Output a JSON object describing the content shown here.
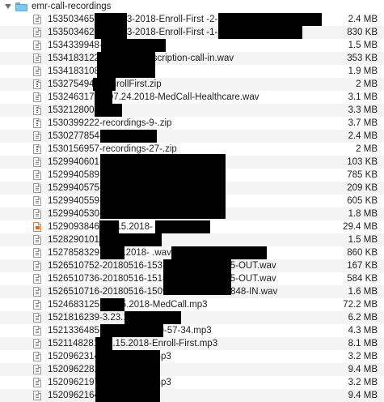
{
  "folder": {
    "name": "emr-call-recordings",
    "icon": "folder-icon"
  },
  "files": [
    {
      "name": "1535034651-          -08-23-2018-Enroll-First                        -2-.wav",
      "size": "2.4 MB",
      "icon": "audio"
    },
    {
      "name": "1535034621-          -08-23-2018-Enroll-First                        -1-.wav",
      "size": "830 KB",
      "icon": "audio"
    },
    {
      "name": "1534339948-                  8.15.18.wav",
      "size": "1.5 MB",
      "icon": "audio"
    },
    {
      "name": "1534183122-                  8.13.18-prescription-call-in.wav",
      "size": "353 KB",
      "icon": "audio"
    },
    {
      "name": "1534183108-                  8.13.18.wav",
      "size": "1.9 MB",
      "icon": "audio"
    },
    {
      "name": "1532754941-      EnrollFirst.zip",
      "size": "2 MB",
      "icon": "zip"
    },
    {
      "name": "1532463175-      -07.24.2018-MedCall-Healthcare.wav",
      "size": "3.1 MB",
      "icon": "audio"
    },
    {
      "name": "1532128004-          .zip",
      "size": "3.3 MB",
      "icon": "zip"
    },
    {
      "name": "1530399222-recordings-9-.zip",
      "size": "3.7 MB",
      "icon": "zip"
    },
    {
      "name": "1530277854-                   6.29.18.wav",
      "size": "2.4 MB",
      "icon": "audio"
    },
    {
      "name": "1530156957-recordings-27-.zip",
      "size": "2 MB",
      "icon": "zip"
    },
    {
      "name": "1529940601-                                    4.wav",
      "size": "103 KB",
      "icon": "audio"
    },
    {
      "name": "1529940589-                                    3.wav",
      "size": "785 KB",
      "icon": "audio"
    },
    {
      "name": "1529940575-                                    2.wav",
      "size": "209 KB",
      "icon": "audio"
    },
    {
      "name": "1529940559-                                    1.wav",
      "size": "605 KB",
      "icon": "audio"
    },
    {
      "name": "1529940530-                                    .wav",
      "size": "1.8 MB",
      "icon": "audio"
    },
    {
      "name": "1529093846-      -6.15.2018-                 ",
      "size": "29.4 MB",
      "icon": "doc"
    },
    {
      "name": "1528290101-             -6.6.18.wav",
      "size": "1.5 MB",
      "icon": "audio"
    },
    {
      "name": "1527858329-          06012018-                         .wav",
      "size": "860 KB",
      "icon": "audio"
    },
    {
      "name": "1526510752-20180516-153756-                  7135827325-OUT.wav",
      "size": "167 KB",
      "icon": "audio"
    },
    {
      "name": "1526510736-20180516-151849-                  7135827325-OUT.wav",
      "size": "584 KB",
      "icon": "audio"
    },
    {
      "name": "1526510716-20180516-150928-                  +19406132848-IN.wav",
      "size": "1.6 MB",
      "icon": "audio"
    },
    {
      "name": "1524683125-             -4.25.2018-MedCall.mp3",
      "size": "72.2 MB",
      "icon": "audio"
    },
    {
      "name": "1521816239-3.23.18-                 .mp3",
      "size": "6.2 MB",
      "icon": "audio"
    },
    {
      "name": "1521336485-                  -2018-3-17-20-57-34.mp3",
      "size": "4.3 MB",
      "icon": "audio"
    },
    {
      "name": "1521148281-      -3.15.2018-Enroll-First.mp3",
      "size": "8.1 MB",
      "icon": "audio"
    },
    {
      "name": "1520962314-                  -3.13.18-2-.mp3",
      "size": "3.2 MB",
      "icon": "audio"
    },
    {
      "name": "1520962281-                  -3.13.18.mp3",
      "size": "9.4 MB",
      "icon": "audio"
    },
    {
      "name": "1520962197-                  -3.13.18-2-.mp3",
      "size": "3.2 MB",
      "icon": "audio"
    },
    {
      "name": "1520962164-                  -3.13.18.mp3",
      "size": "9.4 MB",
      "icon": "audio"
    }
  ]
}
